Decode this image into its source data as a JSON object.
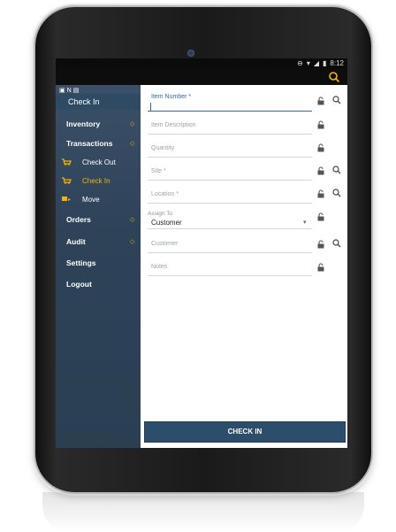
{
  "status": {
    "time": "8:12"
  },
  "appbar": {
    "search_icon": "search-icon"
  },
  "drawer": {
    "title": "Check In",
    "items": [
      {
        "label": "Inventory"
      },
      {
        "label": "Transactions"
      },
      {
        "label": "Orders"
      },
      {
        "label": "Audit"
      },
      {
        "label": "Settings"
      },
      {
        "label": "Logout"
      }
    ],
    "sub_items": [
      {
        "label": "Check Out"
      },
      {
        "label": "Check In"
      },
      {
        "label": "Move"
      }
    ]
  },
  "form": {
    "item_number": {
      "label": "Item Number *"
    },
    "item_description": {
      "label": "Item Description"
    },
    "quantity": {
      "label": "Quantity"
    },
    "site": {
      "label": "Site *"
    },
    "location": {
      "label": "Location *"
    },
    "assign_to": {
      "label": "Assign To",
      "value": "Customer"
    },
    "customer": {
      "label": "Customer"
    },
    "notes": {
      "label": "Notes"
    }
  },
  "actions": {
    "check_in_label": "CHECK IN"
  },
  "colors": {
    "accent": "#f5b400",
    "primary": "#2c4d6b",
    "drawer": "#2e4358"
  }
}
